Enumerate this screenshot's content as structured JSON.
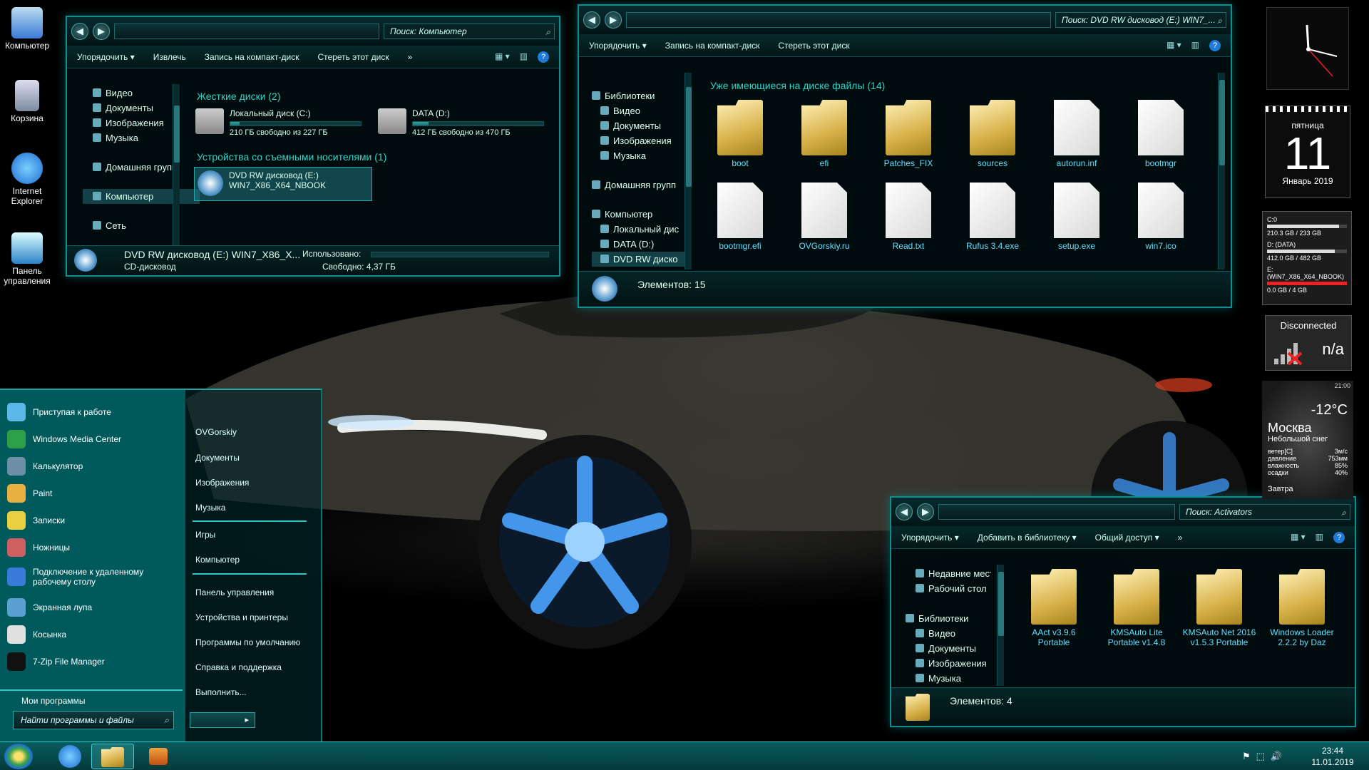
{
  "desktop_icons": [
    {
      "label": "Компьютер",
      "color": "#4aa3ff"
    },
    {
      "label": "Корзина",
      "color": "#7ab4d0"
    },
    {
      "label": "Internet Explorer",
      "color": "#2e8fe0"
    },
    {
      "label": "Панель управления",
      "color": "#45a0d8"
    }
  ],
  "win1": {
    "search_placeholder": "Поиск: Компьютер",
    "toolbar": [
      "Упорядочить ▾",
      "Извлечь",
      "Запись на компакт-диск",
      "Стереть этот диск",
      "»"
    ],
    "nav": [
      "Видео",
      "Документы",
      "Изображения",
      "Музыка",
      "Домашняя групп",
      "Компьютер",
      "Сеть"
    ],
    "hdd_header": "Жесткие диски (2)",
    "removable_header": "Устройства со съемными носителями (1)",
    "drives": [
      {
        "name": "Локальный диск (C:)",
        "free": "210 ГБ свободно из 227 ГБ",
        "used_pct": 7
      },
      {
        "name": "DATA (D:)",
        "free": "412 ГБ свободно из 470 ГБ",
        "used_pct": 12
      }
    ],
    "dvd_label_1": "DVD RW дисковод (E:)",
    "dvd_label_2": "WIN7_X86_X64_NBOOK",
    "status_title": "DVD RW дисковод (E:) WIN7_X86_X...",
    "status_type": "CD-дисковод",
    "status_used_label": "Использовано:",
    "status_free": "Свободно: 4,37 ГБ"
  },
  "win2": {
    "search_placeholder": "Поиск: DVD RW дисковод (E:) WIN7_...",
    "toolbar": [
      "Упорядочить ▾",
      "Запись на компакт-диск",
      "Стереть этот диск"
    ],
    "nav": [
      "Библиотеки",
      "Видео",
      "Документы",
      "Изображения",
      "Музыка",
      "Домашняя групп",
      "Компьютер",
      "Локальный дис",
      "DATA (D:)",
      "DVD RW диско"
    ],
    "header": "Уже имеющиеся на диске файлы (14)",
    "files": [
      {
        "name": "boot",
        "kind": "folder"
      },
      {
        "name": "efi",
        "kind": "folder"
      },
      {
        "name": "Patches_FIX",
        "kind": "folder"
      },
      {
        "name": "sources",
        "kind": "folder"
      },
      {
        "name": "autorun.inf",
        "kind": "doc"
      },
      {
        "name": "bootmgr",
        "kind": "doc"
      },
      {
        "name": "bootmgr.efi",
        "kind": "doc"
      },
      {
        "name": "OVGorskiy.ru",
        "kind": "doc"
      },
      {
        "name": "Read.txt",
        "kind": "doc"
      },
      {
        "name": "Rufus 3.4.exe",
        "kind": "doc"
      },
      {
        "name": "setup.exe",
        "kind": "doc"
      },
      {
        "name": "win7.ico",
        "kind": "doc"
      }
    ],
    "status": "Элементов: 15"
  },
  "win3": {
    "search_placeholder": "Поиск: Activators",
    "toolbar": [
      "Упорядочить ▾",
      "Добавить в библиотеку ▾",
      "Общий доступ ▾",
      "»"
    ],
    "nav": [
      "Недавние мест",
      "Рабочий стол",
      "",
      "Библиотеки",
      "Видео",
      "Документы",
      "Изображения",
      "Музыка"
    ],
    "files": [
      {
        "name": "AAct v3.9.6 Portable"
      },
      {
        "name": "KMSAuto Lite Portable v1.4.8"
      },
      {
        "name": "KMSAuto Net 2016 v1.5.3 Portable"
      },
      {
        "name": "Windows Loader 2.2.2 by Daz"
      }
    ],
    "status": "Элементов: 4"
  },
  "startmenu": {
    "items": [
      "Приступая к работе",
      "Windows Media Center",
      "Калькулятор",
      "Paint",
      "Записки",
      "Ножницы",
      "Подключение к удаленному рабочему столу",
      "Экранная лупа",
      "Косынка",
      "7-Zip File Manager"
    ],
    "item_colors": [
      "#5bb8e8",
      "#2fa04a",
      "#6c8fa8",
      "#e8b040",
      "#e8d040",
      "#d06060",
      "#3a7ad8",
      "#5aa0d0",
      "#e0e0e0",
      "#111"
    ],
    "all_programs": "Мои программы",
    "search_placeholder": "Найти программы и файлы",
    "right": [
      "OVGorskiy",
      "Документы",
      "Изображения",
      "Музыка",
      "Игры",
      "Компьютер",
      "Панель управления",
      "Устройства и принтеры",
      "Программы по умолчанию",
      "Справка и поддержка",
      "Выполнить..."
    ],
    "shutdown_arrow": "▸"
  },
  "gadgets": {
    "calendar_day": "пятница",
    "calendar_date": "11",
    "calendar_month": "Январь 2019",
    "drives": [
      {
        "label": "C:0",
        "size": "210.3 GB / 233 GB",
        "pct": 90
      },
      {
        "label": "D: (DATA)",
        "size": "412.0 GB / 482 GB",
        "pct": 85
      },
      {
        "label": "E: (WIN7_X86_X64_NBOOK)",
        "size": "0.0 GB / 4 GB",
        "pct": 100
      }
    ],
    "network_status": "Disconnected",
    "network_value": "n/a",
    "weather_time": "21:00",
    "weather_temp": "-12°C",
    "weather_city": "Москва",
    "weather_desc": "Небольшой снег",
    "weather_rows": [
      {
        "label": "ветер[С]",
        "value": "3м/с"
      },
      {
        "label": "давление",
        "value": "753мм"
      },
      {
        "label": "влажность",
        "value": "85%"
      },
      {
        "label": "осадки",
        "value": "40%"
      }
    ],
    "weather_tomorrow": "Завтра"
  },
  "taskbar": {
    "time": "23:44",
    "date": "11.01.2019"
  }
}
